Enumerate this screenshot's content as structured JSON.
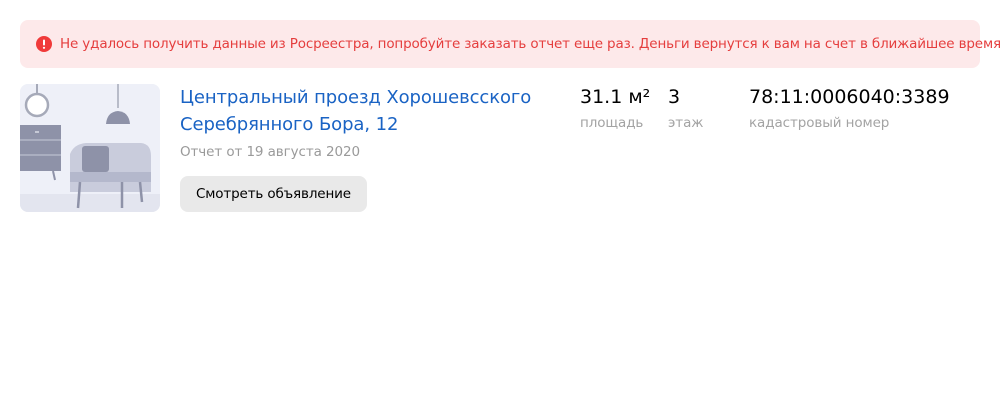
{
  "colors": {
    "alert_background": "#fde9ea",
    "alert_text": "#e53e3e",
    "alert_icon": "#f03a3a",
    "link": "#1a63c4",
    "muted": "#9a9a9a",
    "button_background": "#e9e9e9"
  },
  "alert": {
    "icon": "exclamation-circle-icon",
    "text": "Не удалось получить данные из Росреестра, попробуйте заказать отчет еще раз. Деньги вернутся к вам на счет в ближайшее время."
  },
  "report": {
    "image": "apartment-illustration",
    "address_line1": "Центральный проезд Хорошевсского",
    "address_line2": "Серебрянного Бора, 12",
    "date": "Отчет от 19 августа 2020",
    "view_button_label": "Смотреть объявление",
    "area": {
      "value": "31.1 м²",
      "label": "площадь"
    },
    "floor": {
      "value": "3",
      "label": "этаж"
    },
    "cadastral": {
      "value": "78:11:0006040:3389",
      "label": "кадастровый номер"
    }
  }
}
